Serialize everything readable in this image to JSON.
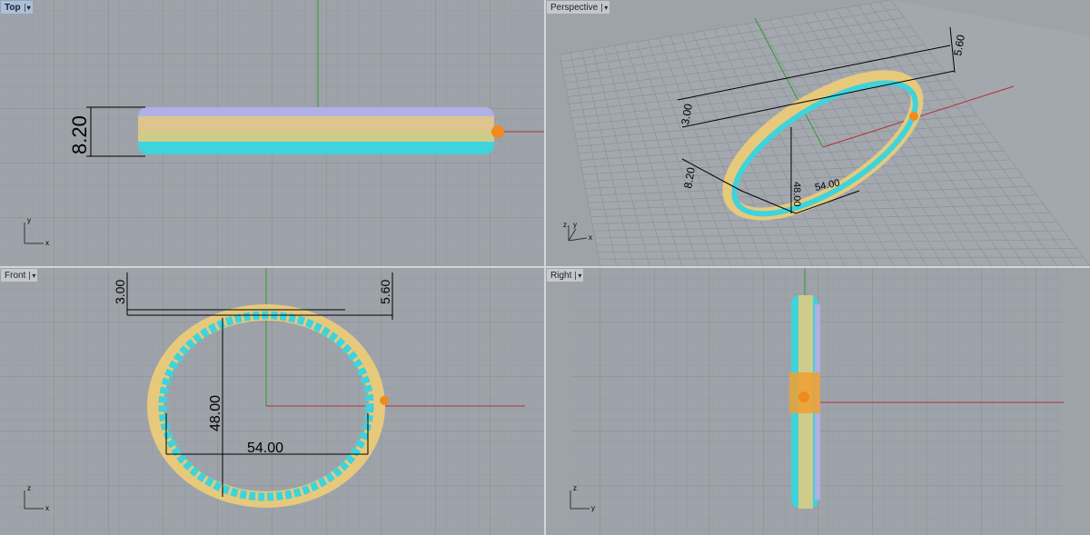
{
  "viewports": [
    {
      "name": "Top",
      "active": true,
      "axes": [
        "y",
        "x"
      ],
      "dimensions": [
        "8.20"
      ]
    },
    {
      "name": "Perspective",
      "active": false,
      "axes": [
        "z",
        "y",
        "x"
      ],
      "dimensions": [
        "5.60",
        "3.00",
        "8.20",
        "48.00",
        "54.00"
      ]
    },
    {
      "name": "Front",
      "active": false,
      "axes": [
        "z",
        "x"
      ],
      "dimensions": [
        "3.00",
        "5.60",
        "48.00",
        "54.00"
      ]
    },
    {
      "name": "Right",
      "active": false,
      "axes": [
        "z",
        "y"
      ],
      "dimensions": []
    }
  ],
  "colors": {
    "background": "#9ea3aa",
    "grid": "#8d9298",
    "x_axis": "#b03030",
    "y_axis": "#2e9a2e",
    "cyan": "#3fd3dc",
    "gold": "#e7c97c",
    "orange": "#f08a1e",
    "lavender": "#aeb0e6"
  }
}
